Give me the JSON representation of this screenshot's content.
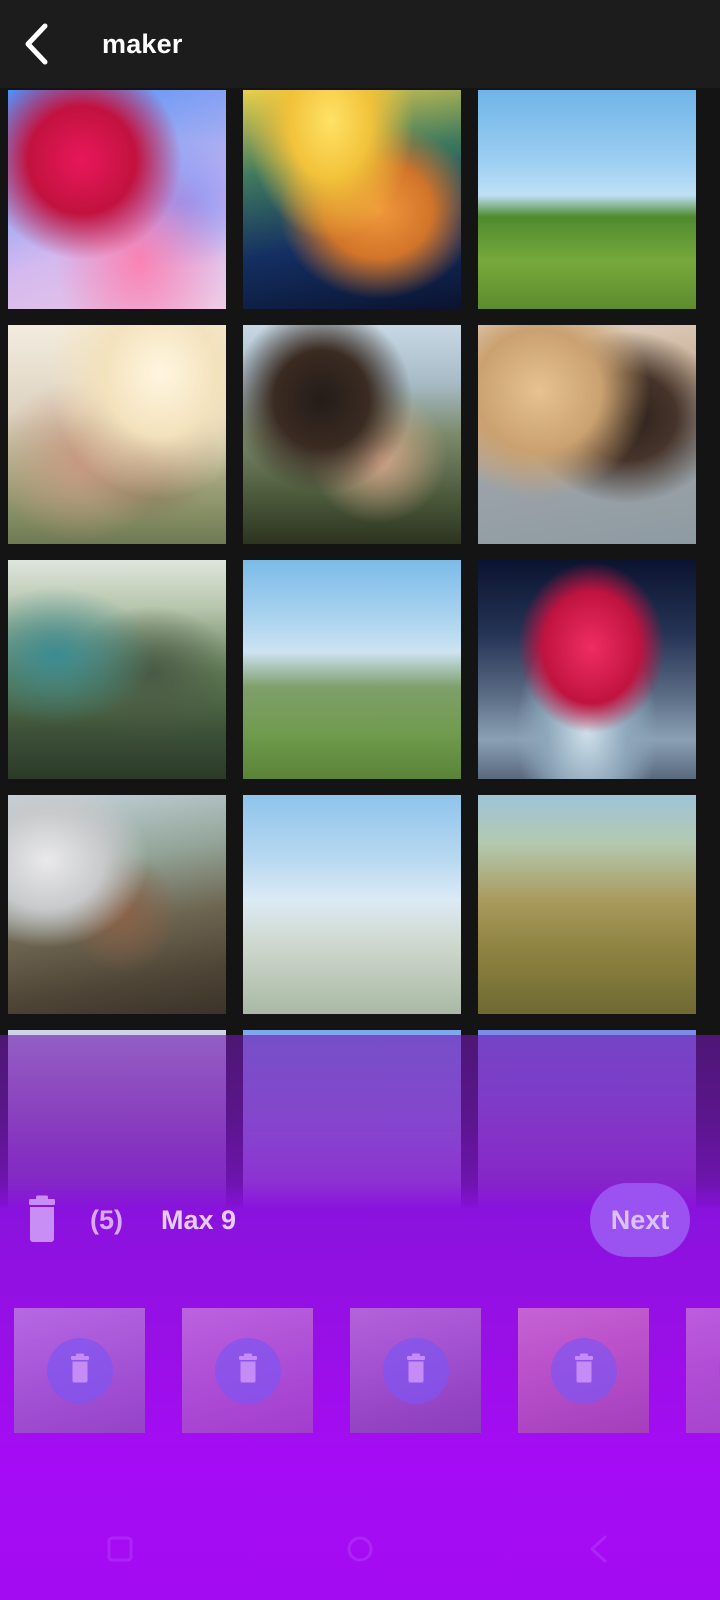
{
  "app": {
    "title": "maker",
    "header_bg": "#1c1c1c",
    "page_bg": "#141414",
    "accent": "#a50cf5"
  },
  "header": {
    "back_icon": "chevron-left-icon",
    "title": "maker"
  },
  "gallery": {
    "columns": 3,
    "items": [
      {
        "id": 1,
        "art": "ph-heart3d",
        "alt": "3d-red-heart-gradient",
        "selected": false
      },
      {
        "id": 2,
        "art": "ph-hands",
        "alt": "holding-hands-sunset",
        "selected": false
      },
      {
        "id": 3,
        "art": "ph-bike",
        "alt": "couple-on-bicycle-field",
        "selected": false
      },
      {
        "id": 4,
        "art": "ph-couple-sun",
        "alt": "smiling-couple-sunlight",
        "selected": false
      },
      {
        "id": 5,
        "art": "ph-hug-field",
        "alt": "couple-hugging-outdoors",
        "selected": false
      },
      {
        "id": 6,
        "art": "ph-hug-warm",
        "alt": "couple-hugging-laughing",
        "selected": false
      },
      {
        "id": 7,
        "art": "ph-walk",
        "alt": "couple-walking-park",
        "selected": false
      },
      {
        "id": 8,
        "art": "ph-jump",
        "alt": "couple-arms-open-hills",
        "selected": false
      },
      {
        "id": 9,
        "art": "ph-splash",
        "alt": "red-heart-water-splash",
        "selected": false
      },
      {
        "id": 10,
        "art": "ph-selfie",
        "alt": "couple-taking-selfie",
        "selected": false
      },
      {
        "id": 11,
        "art": "ph-hat",
        "alt": "woman-in-hat-arms-raised",
        "selected": false
      },
      {
        "id": 12,
        "art": "ph-hike",
        "alt": "hikers-with-backpacks",
        "selected": false
      },
      {
        "id": 13,
        "art": "ph-point",
        "alt": "couple-pointing-mountain",
        "selected": false
      },
      {
        "id": 14,
        "art": "ph-two-walk",
        "alt": "two-people-walking-ridge",
        "selected": false
      },
      {
        "id": 15,
        "art": "ph-group",
        "alt": "group-of-friends-outdoors",
        "selected": false
      }
    ]
  },
  "action_bar": {
    "trash_icon": "trash-icon",
    "selected_count_label": "(5)",
    "max_label": "Max 9",
    "next_label": "Next",
    "next_bg": "#9a52f0",
    "next_text_color": "#dcc2fb",
    "count_color": "#d9a8f7"
  },
  "selected_strip": {
    "delete_icon": "trash-icon",
    "thumbs": [
      {
        "id": "s1",
        "art": "ph-t1",
        "alt": "selfie-in-car-couple"
      },
      {
        "id": "s2",
        "art": "ph-t2",
        "alt": "three-friends-smiling"
      },
      {
        "id": "s3",
        "art": "ph-t3",
        "alt": "group-of-four-friends"
      },
      {
        "id": "s4",
        "art": "ph-t4",
        "alt": "couple-curly-hair-smiling"
      },
      {
        "id": "s5",
        "art": "ph-t5",
        "alt": "partially-visible-photo"
      }
    ]
  },
  "nav_bar": {
    "recents_icon": "recents-square-icon",
    "home_icon": "home-circle-icon",
    "back_icon": "back-triangle-icon"
  }
}
